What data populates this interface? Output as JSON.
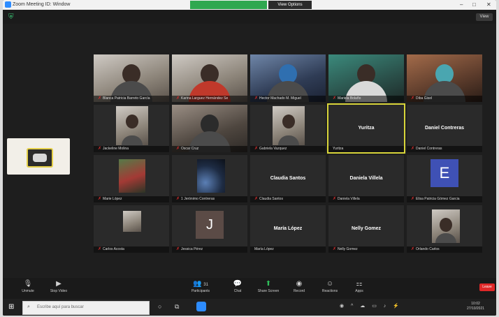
{
  "window": {
    "title": "Zoom Meeting ID: Window",
    "view_options": "View Options",
    "view_label": "View",
    "window_controls": [
      "–",
      "□",
      "✕"
    ]
  },
  "participants": {
    "row1": [
      {
        "name": "Blanca Patricia Barreto García"
      },
      {
        "name": "Karina Larguez Hernández Se"
      },
      {
        "name": "Hector Machado M. Miguel"
      },
      {
        "name": "Mariela Bolaño"
      },
      {
        "name": "Diba Gisel"
      }
    ],
    "row2": [
      {
        "name": "Jackeline Molina"
      },
      {
        "name": "Oscar Cruz"
      },
      {
        "name": "Gabriela Vazquez"
      },
      {
        "name": "Yuritza",
        "label": "Yuritza"
      },
      {
        "name": "Daniel Contreras",
        "label": "Daniel Contreras"
      }
    ],
    "row3": [
      {
        "name": "Marie López"
      },
      {
        "name": "1 Jerónimo Contreras"
      },
      {
        "name": "Claudia Santos",
        "label": "Claudia Santos"
      },
      {
        "name": "Daniela Villela",
        "label": "Daniela Villela"
      },
      {
        "name": "Elisa Patricia Gómez Garcia",
        "letter": "E"
      }
    ],
    "row4": [
      {
        "name": "Carlos Acosta"
      },
      {
        "name": "Jessica Pérez",
        "letter": "J"
      },
      {
        "name": "María López",
        "label": "María López"
      },
      {
        "name": "Nelly Gomez",
        "label": "Nelly Gomez"
      },
      {
        "name": "Orlando Carlos"
      }
    ]
  },
  "toolbar": {
    "unmute": "Unmute",
    "stop_video": "Stop Video",
    "participants": "Participants",
    "participants_count": "31",
    "chat": "Chat",
    "share_screen": "Share Screen",
    "record": "Record",
    "reactions": "Reactions",
    "apps": "Apps",
    "end": "Leave"
  },
  "taskbar": {
    "search_placeholder": "Escribe aquí para buscar",
    "clock_time": "10:02",
    "clock_date": "27/10/2021"
  },
  "colors": {
    "active_speaker": "#d8d53a",
    "share_green": "#2fbf5a",
    "end_red": "#e02828",
    "zoom_blue": "#2d8cff"
  }
}
